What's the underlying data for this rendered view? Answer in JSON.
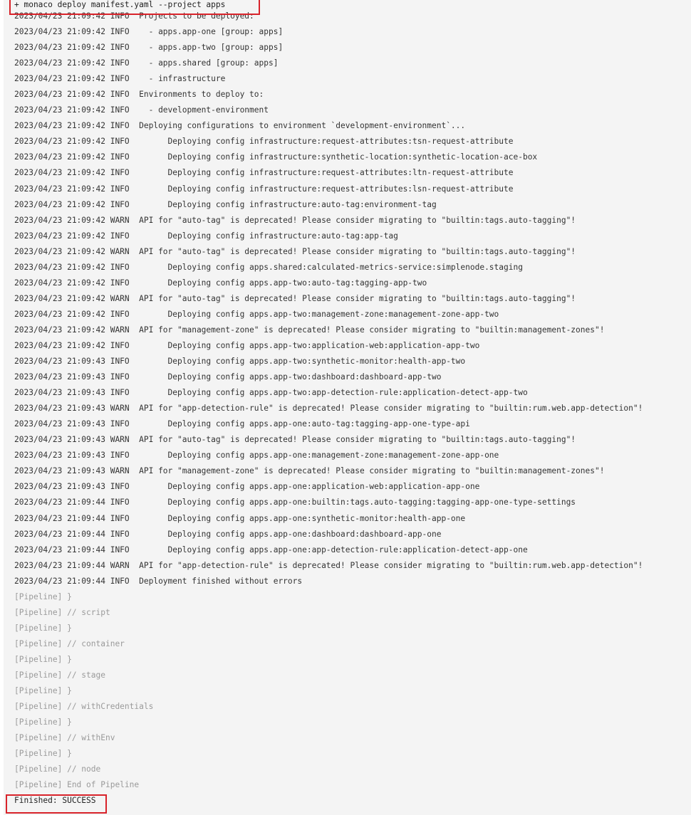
{
  "console": {
    "command": "+ monaco deploy manifest.yaml --project apps",
    "log_lines": [
      "2023/04/23 21:09:42 INFO  Projects to be deployed:",
      "2023/04/23 21:09:42 INFO    - apps.app-one [group: apps]",
      "2023/04/23 21:09:42 INFO    - apps.app-two [group: apps]",
      "2023/04/23 21:09:42 INFO    - apps.shared [group: apps]",
      "2023/04/23 21:09:42 INFO    - infrastructure",
      "2023/04/23 21:09:42 INFO  Environments to deploy to:",
      "2023/04/23 21:09:42 INFO    - development-environment",
      "2023/04/23 21:09:42 INFO  Deploying configurations to environment `development-environment`...",
      "2023/04/23 21:09:42 INFO        Deploying config infrastructure:request-attributes:tsn-request-attribute",
      "2023/04/23 21:09:42 INFO        Deploying config infrastructure:synthetic-location:synthetic-location-ace-box",
      "2023/04/23 21:09:42 INFO        Deploying config infrastructure:request-attributes:ltn-request-attribute",
      "2023/04/23 21:09:42 INFO        Deploying config infrastructure:request-attributes:lsn-request-attribute",
      "2023/04/23 21:09:42 INFO        Deploying config infrastructure:auto-tag:environment-tag",
      "2023/04/23 21:09:42 WARN  API for \"auto-tag\" is deprecated! Please consider migrating to \"builtin:tags.auto-tagging\"!",
      "2023/04/23 21:09:42 INFO        Deploying config infrastructure:auto-tag:app-tag",
      "2023/04/23 21:09:42 WARN  API for \"auto-tag\" is deprecated! Please consider migrating to \"builtin:tags.auto-tagging\"!",
      "2023/04/23 21:09:42 INFO        Deploying config apps.shared:calculated-metrics-service:simplenode.staging",
      "2023/04/23 21:09:42 INFO        Deploying config apps.app-two:auto-tag:tagging-app-two",
      "2023/04/23 21:09:42 WARN  API for \"auto-tag\" is deprecated! Please consider migrating to \"builtin:tags.auto-tagging\"!",
      "2023/04/23 21:09:42 INFO        Deploying config apps.app-two:management-zone:management-zone-app-two",
      "2023/04/23 21:09:42 WARN  API for \"management-zone\" is deprecated! Please consider migrating to \"builtin:management-zones\"!",
      "2023/04/23 21:09:42 INFO        Deploying config apps.app-two:application-web:application-app-two",
      "2023/04/23 21:09:43 INFO        Deploying config apps.app-two:synthetic-monitor:health-app-two",
      "2023/04/23 21:09:43 INFO        Deploying config apps.app-two:dashboard:dashboard-app-two",
      "2023/04/23 21:09:43 INFO        Deploying config apps.app-two:app-detection-rule:application-detect-app-two",
      "2023/04/23 21:09:43 WARN  API for \"app-detection-rule\" is deprecated! Please consider migrating to \"builtin:rum.web.app-detection\"!",
      "2023/04/23 21:09:43 INFO        Deploying config apps.app-one:auto-tag:tagging-app-one-type-api",
      "2023/04/23 21:09:43 WARN  API for \"auto-tag\" is deprecated! Please consider migrating to \"builtin:tags.auto-tagging\"!",
      "2023/04/23 21:09:43 INFO        Deploying config apps.app-one:management-zone:management-zone-app-one",
      "2023/04/23 21:09:43 WARN  API for \"management-zone\" is deprecated! Please consider migrating to \"builtin:management-zones\"!",
      "2023/04/23 21:09:43 INFO        Deploying config apps.app-one:application-web:application-app-one",
      "2023/04/23 21:09:44 INFO        Deploying config apps.app-one:builtin:tags.auto-tagging:tagging-app-one-type-settings",
      "2023/04/23 21:09:44 INFO        Deploying config apps.app-one:synthetic-monitor:health-app-one",
      "2023/04/23 21:09:44 INFO        Deploying config apps.app-one:dashboard:dashboard-app-one",
      "2023/04/23 21:09:44 INFO        Deploying config apps.app-one:app-detection-rule:application-detect-app-one",
      "2023/04/23 21:09:44 WARN  API for \"app-detection-rule\" is deprecated! Please consider migrating to \"builtin:rum.web.app-detection\"!",
      "2023/04/23 21:09:44 INFO  Deployment finished without errors"
    ],
    "pipeline_lines": [
      "[Pipeline] }",
      "[Pipeline] // script",
      "[Pipeline] }",
      "[Pipeline] // container",
      "[Pipeline] }",
      "[Pipeline] // stage",
      "[Pipeline] }",
      "[Pipeline] // withCredentials",
      "[Pipeline] }",
      "[Pipeline] // withEnv",
      "[Pipeline] }",
      "[Pipeline] // node",
      "[Pipeline] End of Pipeline"
    ],
    "finished": "Finished: SUCCESS"
  },
  "colors": {
    "background": "#f4f4f4",
    "text": "#333333",
    "pipeline_text": "#9a9a9a",
    "highlight": "#d8232a"
  }
}
